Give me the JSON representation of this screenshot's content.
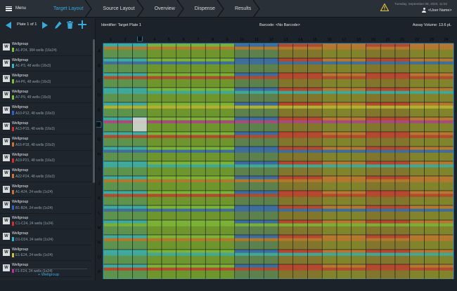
{
  "topbar": {
    "menu_label": "Menu",
    "steps": [
      {
        "label": "Target Layout",
        "active": true
      },
      {
        "label": "Source Layout",
        "active": false
      },
      {
        "label": "Overview",
        "active": false
      },
      {
        "label": "Dispense",
        "active": false
      },
      {
        "label": "Results",
        "active": false
      }
    ],
    "datetime": "Tuesday, September 08, 2020, 11:02",
    "user": "<User Name>",
    "warning_icon": "warning-triangle-icon",
    "accent": "#3aa8d8",
    "warning_color": "#e8c43a"
  },
  "plate_nav": {
    "plate_label": "Plate 1 of 1"
  },
  "wellgroups": [
    {
      "name": "Wellgroup",
      "desc": "A1-P24, 384 wells (16x24)",
      "color": "#7fc03a"
    },
    {
      "name": "Wellgroup",
      "desc": "A1-P3, 48 wells (16x3)",
      "color": "#2fb5c8"
    },
    {
      "name": "Wellgroup",
      "desc": "A4-P6, 48 wells (16x3)",
      "color": "#7fc03a"
    },
    {
      "name": "Wellgroup",
      "desc": "A7-P9, 48 wells (16x3)",
      "color": "#7fc03a"
    },
    {
      "name": "Wellgroup",
      "desc": "A10-P12, 48 wells (16x3)",
      "color": "#2d62c9"
    },
    {
      "name": "Wellgroup",
      "desc": "A13-P15, 48 wells (16x3)",
      "color": "#d03030"
    },
    {
      "name": "Wellgroup",
      "desc": "A16-P18, 48 wells (16x3)",
      "color": "#d07030"
    },
    {
      "name": "Wellgroup",
      "desc": "A19-P21, 48 wells (16x3)",
      "color": "#d03030"
    },
    {
      "name": "Wellgroup",
      "desc": "A22-P24, 48 wells (16x3)",
      "color": "#d07030"
    },
    {
      "name": "Wellgroup",
      "desc": "A1-A24, 24 wells (1x24)",
      "color": "#d07030"
    },
    {
      "name": "Wellgroup",
      "desc": "B1-B24, 24 wells (1x24)",
      "color": "#2d62c9"
    },
    {
      "name": "Wellgroup",
      "desc": "C1-C24, 24 wells (1x24)",
      "color": "#d03030"
    },
    {
      "name": "Wellgroup",
      "desc": "D1-D24, 24 wells (1x24)",
      "color": "#2fb5c8"
    },
    {
      "name": "Wellgroup",
      "desc": "E1-E24, 24 wells (1x24)",
      "color": "#d0c030"
    },
    {
      "name": "Wellgroup",
      "desc": "F1-F24, 24 wells (1x24)",
      "color": "#c030a0"
    }
  ],
  "add_wellgroup_label": "+ Wellgroup",
  "info": {
    "identifier": "Identifier: Target Plate 1",
    "barcode": "Barcode: <No Barcode>",
    "assay_volume": "Assay Volume: 13.6 pL"
  },
  "plate": {
    "columns": [
      "1",
      "2",
      "3",
      "4",
      "5",
      "6",
      "7",
      "8",
      "9",
      "10",
      "11",
      "12",
      "13",
      "14",
      "15",
      "16",
      "17",
      "18",
      "19",
      "20",
      "21",
      "22",
      "23",
      "24"
    ],
    "rows": [
      "A",
      "B",
      "C",
      "D",
      "E",
      "F",
      "G",
      "H",
      "I",
      "J",
      "K",
      "L",
      "M",
      "N",
      "O",
      "P"
    ],
    "column_group_colors": [
      "#2fb5c8",
      "#7fc03a",
      "#7fc03a",
      "#2d62c9",
      "#d03030",
      "#d07030",
      "#d03030",
      "#d07030"
    ],
    "row_stripe_colors": [
      "#d07030",
      "#2d62c9",
      "#d03030",
      "#2fb5c8",
      "#d0c030",
      "#c030a0",
      "#d03030",
      "#2d62c9",
      "#2fb5c8",
      "#d07030",
      "#d03030",
      "#2d62c9",
      "#7fc03a",
      "#d07030",
      "#2fb5c8",
      "#d03030"
    ],
    "base_color": "#6b8a2a",
    "selected_well": "F3",
    "selected_column": "3",
    "selected_row": "F"
  }
}
